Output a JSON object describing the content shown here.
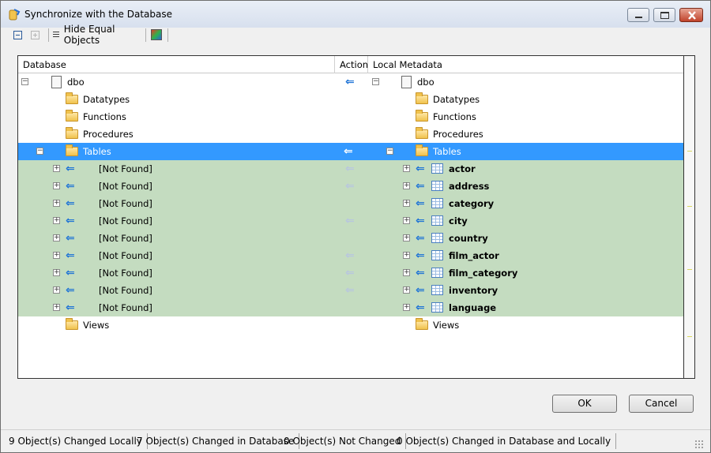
{
  "window": {
    "title": "Synchronize with the Database"
  },
  "toolbar": {
    "hide_equal_label": "Hide Equal Objects"
  },
  "grid": {
    "headers": {
      "database": "Database",
      "action": "Action",
      "local": "Local Metadata"
    },
    "schema": "dbo",
    "folders": {
      "datatypes": "Datatypes",
      "functions": "Functions",
      "procedures": "Procedures",
      "tables": "Tables",
      "views": "Views"
    },
    "not_found": "[Not Found]",
    "tables": [
      "actor",
      "address",
      "category",
      "city",
      "country",
      "film_actor",
      "film_category",
      "inventory",
      "language"
    ]
  },
  "buttons": {
    "ok": "OK",
    "cancel": "Cancel"
  },
  "status": {
    "changed_locally": "9 Object(s) Changed Locally",
    "changed_db": "7 Object(s) Changed in Database",
    "not_changed": "0 Object(s) Not Changed",
    "changed_both": "0 Object(s) Changed in Database and Locally"
  }
}
